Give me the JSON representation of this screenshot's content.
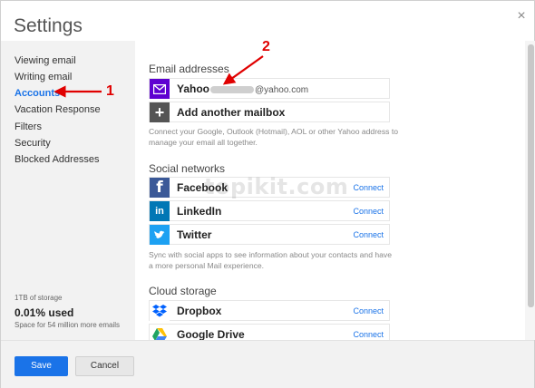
{
  "dialog": {
    "title": "Settings",
    "close_glyph": "×"
  },
  "sidebar": {
    "items": [
      {
        "label": "Viewing email",
        "active": false
      },
      {
        "label": "Writing email",
        "active": false
      },
      {
        "label": "Accounts",
        "active": true
      },
      {
        "label": "Vacation Response",
        "active": false
      },
      {
        "label": "Filters",
        "active": false
      },
      {
        "label": "Security",
        "active": false
      },
      {
        "label": "Blocked Addresses",
        "active": false
      }
    ],
    "storage": {
      "capacity": "1TB of storage",
      "used": "0.01% used",
      "space": "Space for 54 million more emails"
    }
  },
  "email_section": {
    "title": "Email addresses",
    "account": {
      "name": "Yahoo",
      "domain": "@yahoo.com",
      "icon": "yahoo-mail-icon"
    },
    "add": {
      "label": "Add another mailbox",
      "icon": "plus-icon"
    },
    "help": "Connect your Google, Outlook (Hotmail), AOL or other Yahoo address to manage your email all together."
  },
  "social_section": {
    "title": "Social networks",
    "items": [
      {
        "name": "Facebook",
        "action": "Connect",
        "icon": "facebook-icon",
        "color": "#3b5998"
      },
      {
        "name": "LinkedIn",
        "action": "Connect",
        "icon": "linkedin-icon",
        "color": "#0077b5"
      },
      {
        "name": "Twitter",
        "action": "Connect",
        "icon": "twitter-icon",
        "color": "#1da1f2"
      }
    ],
    "help": "Sync with social apps to see information about your contacts and have a more personal Mail experience."
  },
  "cloud_section": {
    "title": "Cloud storage",
    "items": [
      {
        "name": "Dropbox",
        "action": "Connect",
        "icon": "dropbox-icon",
        "color": "#0061fe"
      },
      {
        "name": "Google Drive",
        "action": "Connect",
        "icon": "google-drive-icon",
        "color": "#1fa463"
      }
    ]
  },
  "footer": {
    "save_label": "Save",
    "cancel_label": "Cancel"
  },
  "watermark": "topikit.com",
  "annotations": {
    "label1": "1",
    "label2": "2"
  },
  "colors": {
    "accent": "#1a73e8",
    "annotation": "#e00000",
    "yahoo": "#5f01d1"
  }
}
